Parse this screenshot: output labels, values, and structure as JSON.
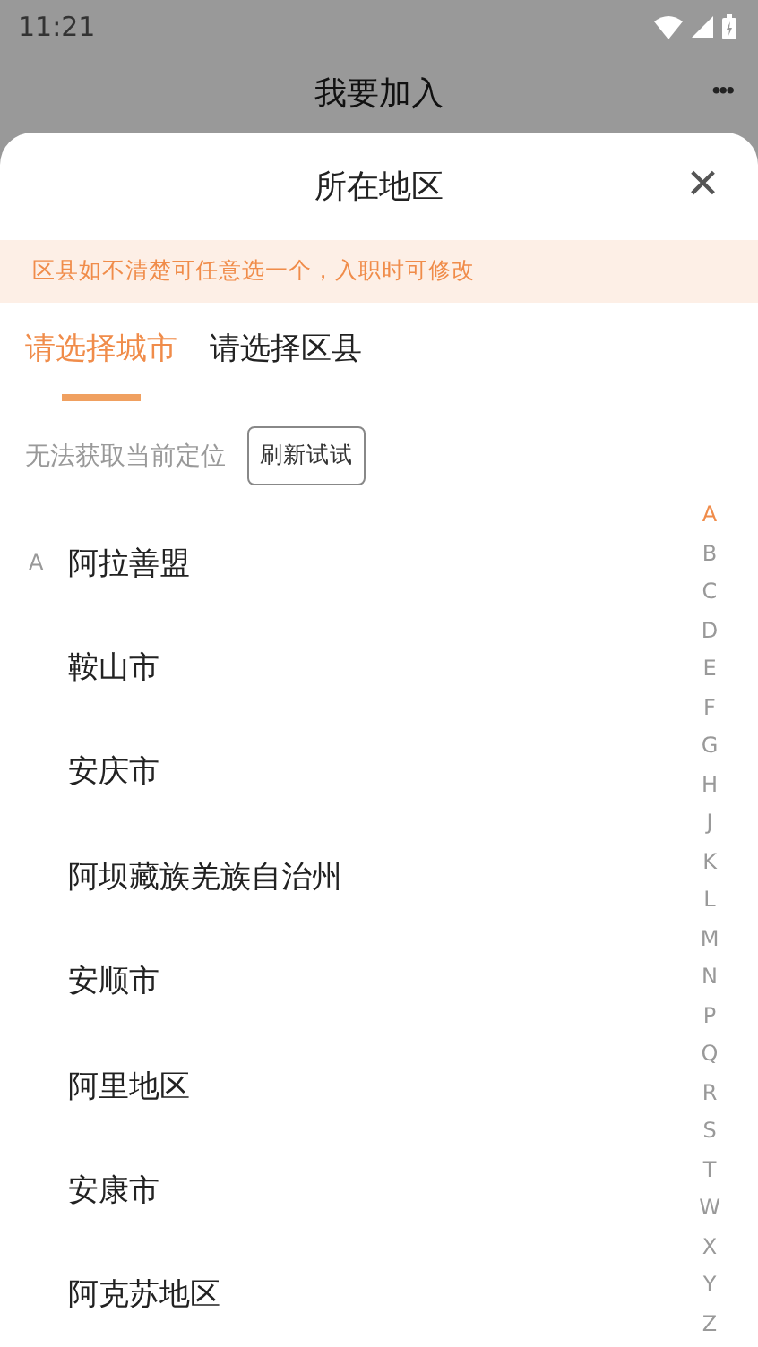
{
  "status_bar": {
    "time": "11:21"
  },
  "header": {
    "title": "我要加入",
    "menu": "•••"
  },
  "sheet": {
    "title": "所在地区",
    "close": "×",
    "notice": "区县如不清楚可任意选一个，入职时可修改"
  },
  "tabs": [
    {
      "label": "请选择城市",
      "selected": true
    },
    {
      "label": "请选择区县",
      "selected": false
    }
  ],
  "location": {
    "message": "无法获取当前定位",
    "button": "刷新试试"
  },
  "cities": [
    {
      "letter": "A",
      "name": "阿拉善盟"
    },
    {
      "name": "鞍山市"
    },
    {
      "name": "安庆市"
    },
    {
      "name": "阿坝藏族羌族自治州"
    },
    {
      "name": "安顺市"
    },
    {
      "name": "阿里地区"
    },
    {
      "name": "安康市"
    },
    {
      "name": "阿克苏地区"
    }
  ],
  "index": [
    {
      "letter": "A",
      "selected": true
    },
    {
      "letter": "B",
      "selected": false
    },
    {
      "letter": "C",
      "selected": false
    },
    {
      "letter": "D",
      "selected": false
    },
    {
      "letter": "E",
      "selected": false
    },
    {
      "letter": "F",
      "selected": false
    },
    {
      "letter": "G",
      "selected": false
    },
    {
      "letter": "H",
      "selected": false
    },
    {
      "letter": "J",
      "selected": false
    },
    {
      "letter": "K",
      "selected": false
    },
    {
      "letter": "L",
      "selected": false
    },
    {
      "letter": "M",
      "selected": false
    },
    {
      "letter": "N",
      "selected": false
    },
    {
      "letter": "P",
      "selected": false
    },
    {
      "letter": "Q",
      "selected": false
    },
    {
      "letter": "R",
      "selected": false
    },
    {
      "letter": "S",
      "selected": false
    },
    {
      "letter": "T",
      "selected": false
    },
    {
      "letter": "W",
      "selected": false
    },
    {
      "letter": "X",
      "selected": false
    },
    {
      "letter": "Y",
      "selected": false
    },
    {
      "letter": "Z",
      "selected": false
    }
  ]
}
